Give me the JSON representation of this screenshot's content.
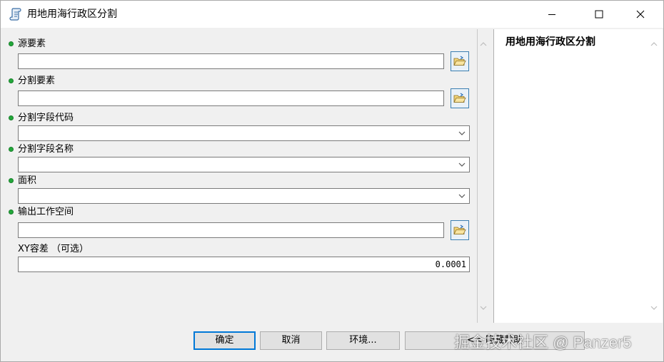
{
  "window": {
    "title": "用地用海行政区分割",
    "icon": "script-tool-icon"
  },
  "params": {
    "source_features": {
      "label": "源要素",
      "value": ""
    },
    "split_features": {
      "label": "分割要素",
      "value": ""
    },
    "split_field_code": {
      "label": "分割字段代码",
      "value": ""
    },
    "split_field_name": {
      "label": "分割字段名称",
      "value": ""
    },
    "area": {
      "label": "面积",
      "value": ""
    },
    "output_workspace": {
      "label": "输出工作空间",
      "value": ""
    },
    "xy_tolerance": {
      "label": "XY容差 （可选）",
      "value": "0.0001"
    }
  },
  "help": {
    "title": "用地用海行政区分割"
  },
  "buttons": {
    "ok": "确定",
    "cancel": "取消",
    "environments": "环境...",
    "hide_help": "<< 隐藏帮助"
  },
  "watermark": "掘金技术社区 @ Panzer5",
  "colors": {
    "required_dot": "#22a83a",
    "focus_border": "#0078d7"
  }
}
